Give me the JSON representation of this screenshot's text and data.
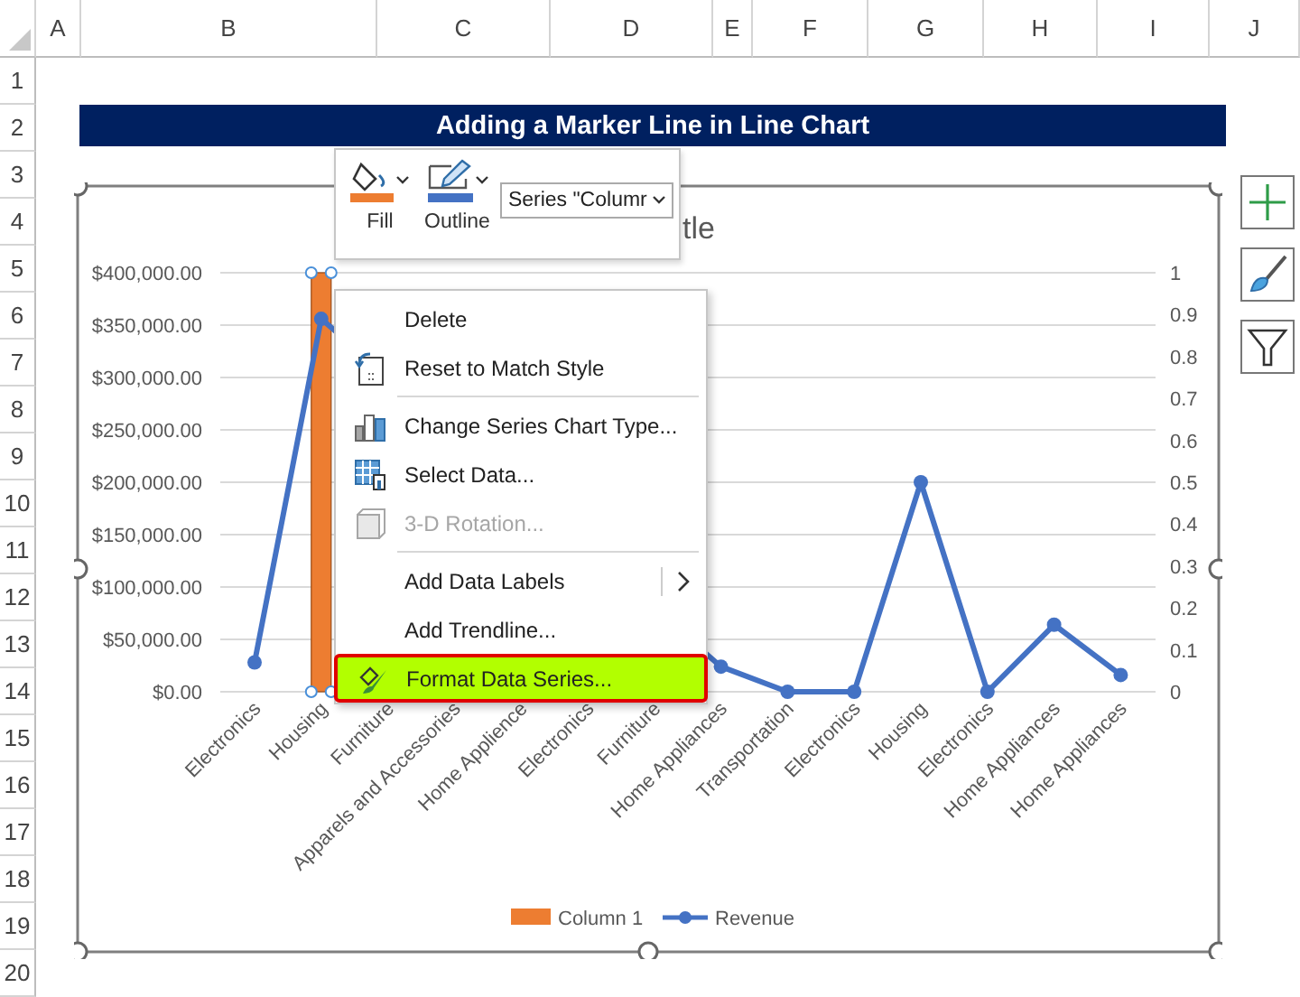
{
  "sheet": {
    "columns": [
      "A",
      "B",
      "C",
      "D",
      "E",
      "F",
      "G",
      "H",
      "I",
      "J"
    ],
    "rows": [
      "1",
      "2",
      "3",
      "4",
      "5",
      "6",
      "7",
      "8",
      "9",
      "10",
      "11",
      "12",
      "13",
      "14",
      "15",
      "16",
      "17",
      "18",
      "19",
      "20"
    ],
    "title": "Adding a Marker Line in Line Chart"
  },
  "chart": {
    "title_fragment": "tle",
    "chart_data": {
      "type": "line",
      "categories": [
        "Electronics",
        "Housing",
        "Furniture",
        "Apparels and Accessories",
        "Home Applience",
        "Electronics",
        "Furniture",
        "Home Appliances",
        "Transportation",
        "Electronics",
        "Housing",
        "Electronics",
        "Home Appliances",
        "Home Appliances"
      ],
      "series": [
        {
          "name": "Column 1",
          "type": "bar",
          "color": "#ed7d31",
          "values": [
            0,
            400000,
            0,
            0,
            0,
            0,
            0,
            0,
            0,
            0,
            0,
            0,
            0,
            0
          ]
        },
        {
          "name": "Revenue",
          "type": "line",
          "color": "#4472c4",
          "axis": "y2",
          "marker": "circle",
          "values": [
            0.07,
            0.89,
            null,
            null,
            null,
            null,
            null,
            0.06,
            0,
            0,
            0.5,
            0,
            0.16,
            0.04
          ]
        }
      ],
      "grid": true,
      "legend": true,
      "ylim": [
        0,
        400000
      ],
      "yticks": [
        {
          "value": 0,
          "label": "$0.00"
        },
        {
          "value": 50000,
          "label": "$50,000.00"
        },
        {
          "value": 100000,
          "label": "$100,000.00"
        },
        {
          "value": 150000,
          "label": "$150,000.00"
        },
        {
          "value": 200000,
          "label": "$200,000.00"
        },
        {
          "value": 250000,
          "label": "$250,000.00"
        },
        {
          "value": 300000,
          "label": "$300,000.00"
        },
        {
          "value": 350000,
          "label": "$350,000.00"
        },
        {
          "value": 400000,
          "label": "$400,000.00"
        }
      ],
      "y2lim": [
        0,
        1
      ],
      "y2ticks": [
        0,
        0.1,
        0.2,
        0.3,
        0.4,
        0.5,
        0.6,
        0.7,
        0.8,
        0.9,
        1
      ]
    }
  },
  "mini_toolbar": {
    "fill_label": "Fill",
    "outline_label": "Outline",
    "series_dropdown": "Series \"Columr"
  },
  "context_menu": {
    "items": [
      {
        "kind": "item",
        "label": "Delete",
        "disabled": false,
        "selected": false,
        "submenu": false
      },
      {
        "kind": "item",
        "label": "Reset to Match Style",
        "disabled": false,
        "selected": false,
        "submenu": false
      },
      {
        "kind": "separator"
      },
      {
        "kind": "item",
        "label": "Change Series Chart Type...",
        "disabled": false,
        "selected": false,
        "submenu": false
      },
      {
        "kind": "item",
        "label": "Select Data...",
        "disabled": false,
        "selected": false,
        "submenu": false
      },
      {
        "kind": "item",
        "label": "3-D Rotation...",
        "disabled": true,
        "selected": false,
        "submenu": false
      },
      {
        "kind": "separator"
      },
      {
        "kind": "item",
        "label": "Add Data Labels",
        "disabled": false,
        "selected": false,
        "submenu": true
      },
      {
        "kind": "item",
        "label": "Add Trendline...",
        "disabled": false,
        "selected": false,
        "submenu": false
      },
      {
        "kind": "item",
        "label": "Format Data Series...",
        "disabled": false,
        "selected": true,
        "submenu": false
      }
    ]
  }
}
